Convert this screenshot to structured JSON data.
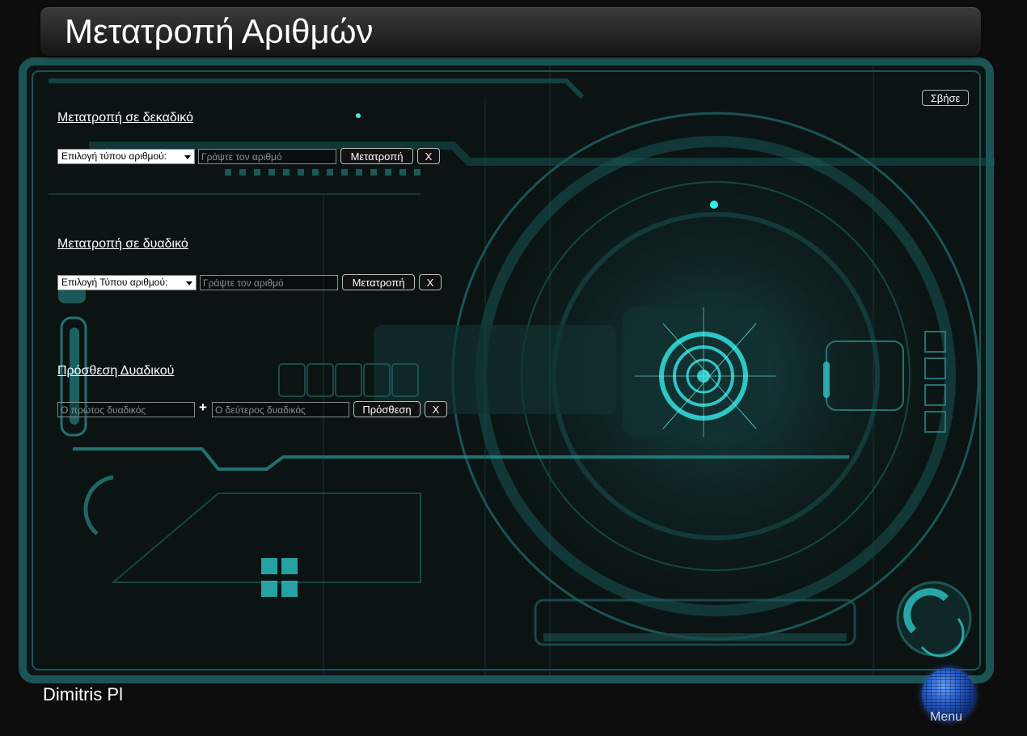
{
  "header": {
    "title": "Μετατροπή Αριθμών"
  },
  "toolbar": {
    "clear_all_label": "Σβήσε"
  },
  "to_decimal": {
    "title": "Μετατροπή σε δεκαδικό",
    "select_value": "Επιλογή τύπου αριθμού:",
    "input_placeholder": "Γράψτε τον αριθμό",
    "convert_label": "Μετατροπή",
    "clear_label": "X"
  },
  "to_binary": {
    "title": "Μετατροπή σε δυαδικό",
    "select_value": "Επιλογή Τύπου αριθμού:",
    "input_placeholder": "Γράψτε τον αριθμό",
    "convert_label": "Μετατροπή",
    "clear_label": "X"
  },
  "binary_add": {
    "title": "Πρόσθεση Δυαδικού",
    "first_placeholder": "Ο πρώτος δυαδικός",
    "plus": "+",
    "second_placeholder": "Ο δεύτερος δυαδικός",
    "add_label": "Πρόσθεση",
    "clear_label": "X"
  },
  "footer": {
    "author": "Dimitris Pl",
    "menu_label": "Menu"
  },
  "colors": {
    "accent": "#2ec6c6",
    "background": "#0d0d0d",
    "panel": "#0f3a3a"
  }
}
